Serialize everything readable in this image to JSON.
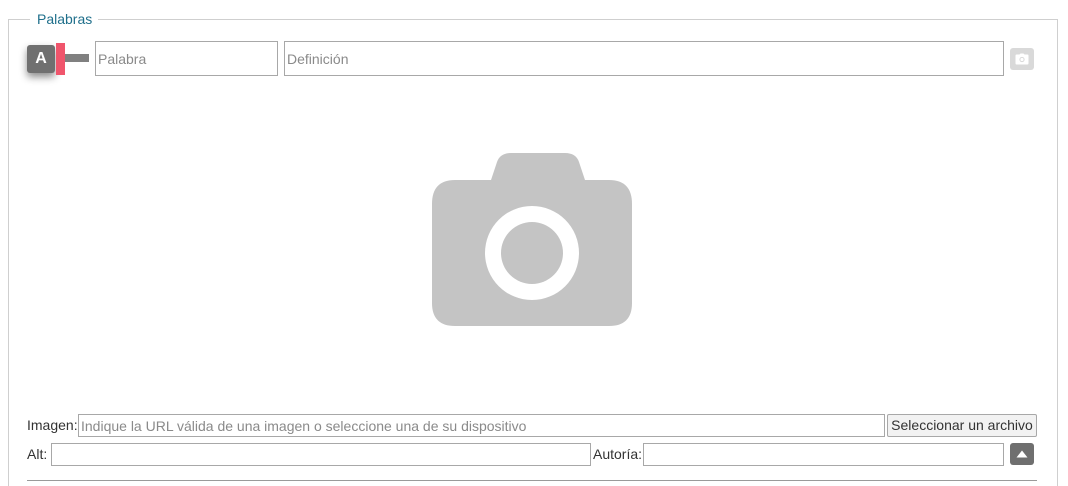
{
  "section": {
    "legend": "Palabras"
  },
  "word_row": {
    "letter": "A",
    "word_placeholder": "Palabra",
    "definition_placeholder": "Definición",
    "word_value": "",
    "definition_value": ""
  },
  "image": {
    "image_label": "Imagen:",
    "url_placeholder": "Indique la URL válida de una imagen o seleccione una de su dispositivo",
    "url_value": "",
    "file_button_label": "Seleccionar un archivo",
    "alt_label": "Alt:",
    "alt_value": "",
    "author_label": "Autoría:",
    "author_value": ""
  },
  "colors": {
    "legend": "#1f6f8b",
    "accent_tab": "#f0556c",
    "badge": "#707070",
    "camera_placeholder": "#c4c4c4"
  },
  "icons": {
    "small_camera": "camera-icon",
    "big_camera": "image-placeholder-camera-icon",
    "collapse": "caret-up-icon"
  }
}
